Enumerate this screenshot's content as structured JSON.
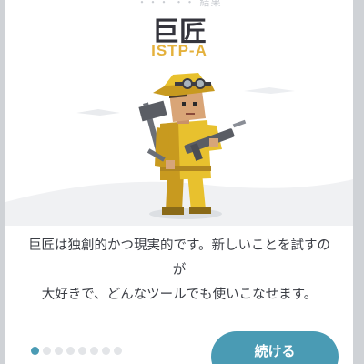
{
  "header": {
    "top_faint_text": "・・・ ・・ 結果",
    "title": "巨匠",
    "type_code": "ISTP-A"
  },
  "illustration": {
    "name": "virtuoso-character-with-tools-icon",
    "colors": {
      "clothing": "#e8c12e",
      "clothing_shadow": "#c89a1f",
      "ground": "#f0f1f3",
      "tool": "#5a5d64"
    }
  },
  "body": {
    "description_line1": "巨匠は独創的かつ現実的です。新しいことを試すのが",
    "description_line2": "大好きで、どんなツールでも使いこなせます。"
  },
  "footer": {
    "pager": {
      "total": 8,
      "active_index": 0
    },
    "continue_label": "続ける"
  },
  "theme": {
    "accent": "#4a9bb4",
    "type_color": "#e4b13c"
  }
}
